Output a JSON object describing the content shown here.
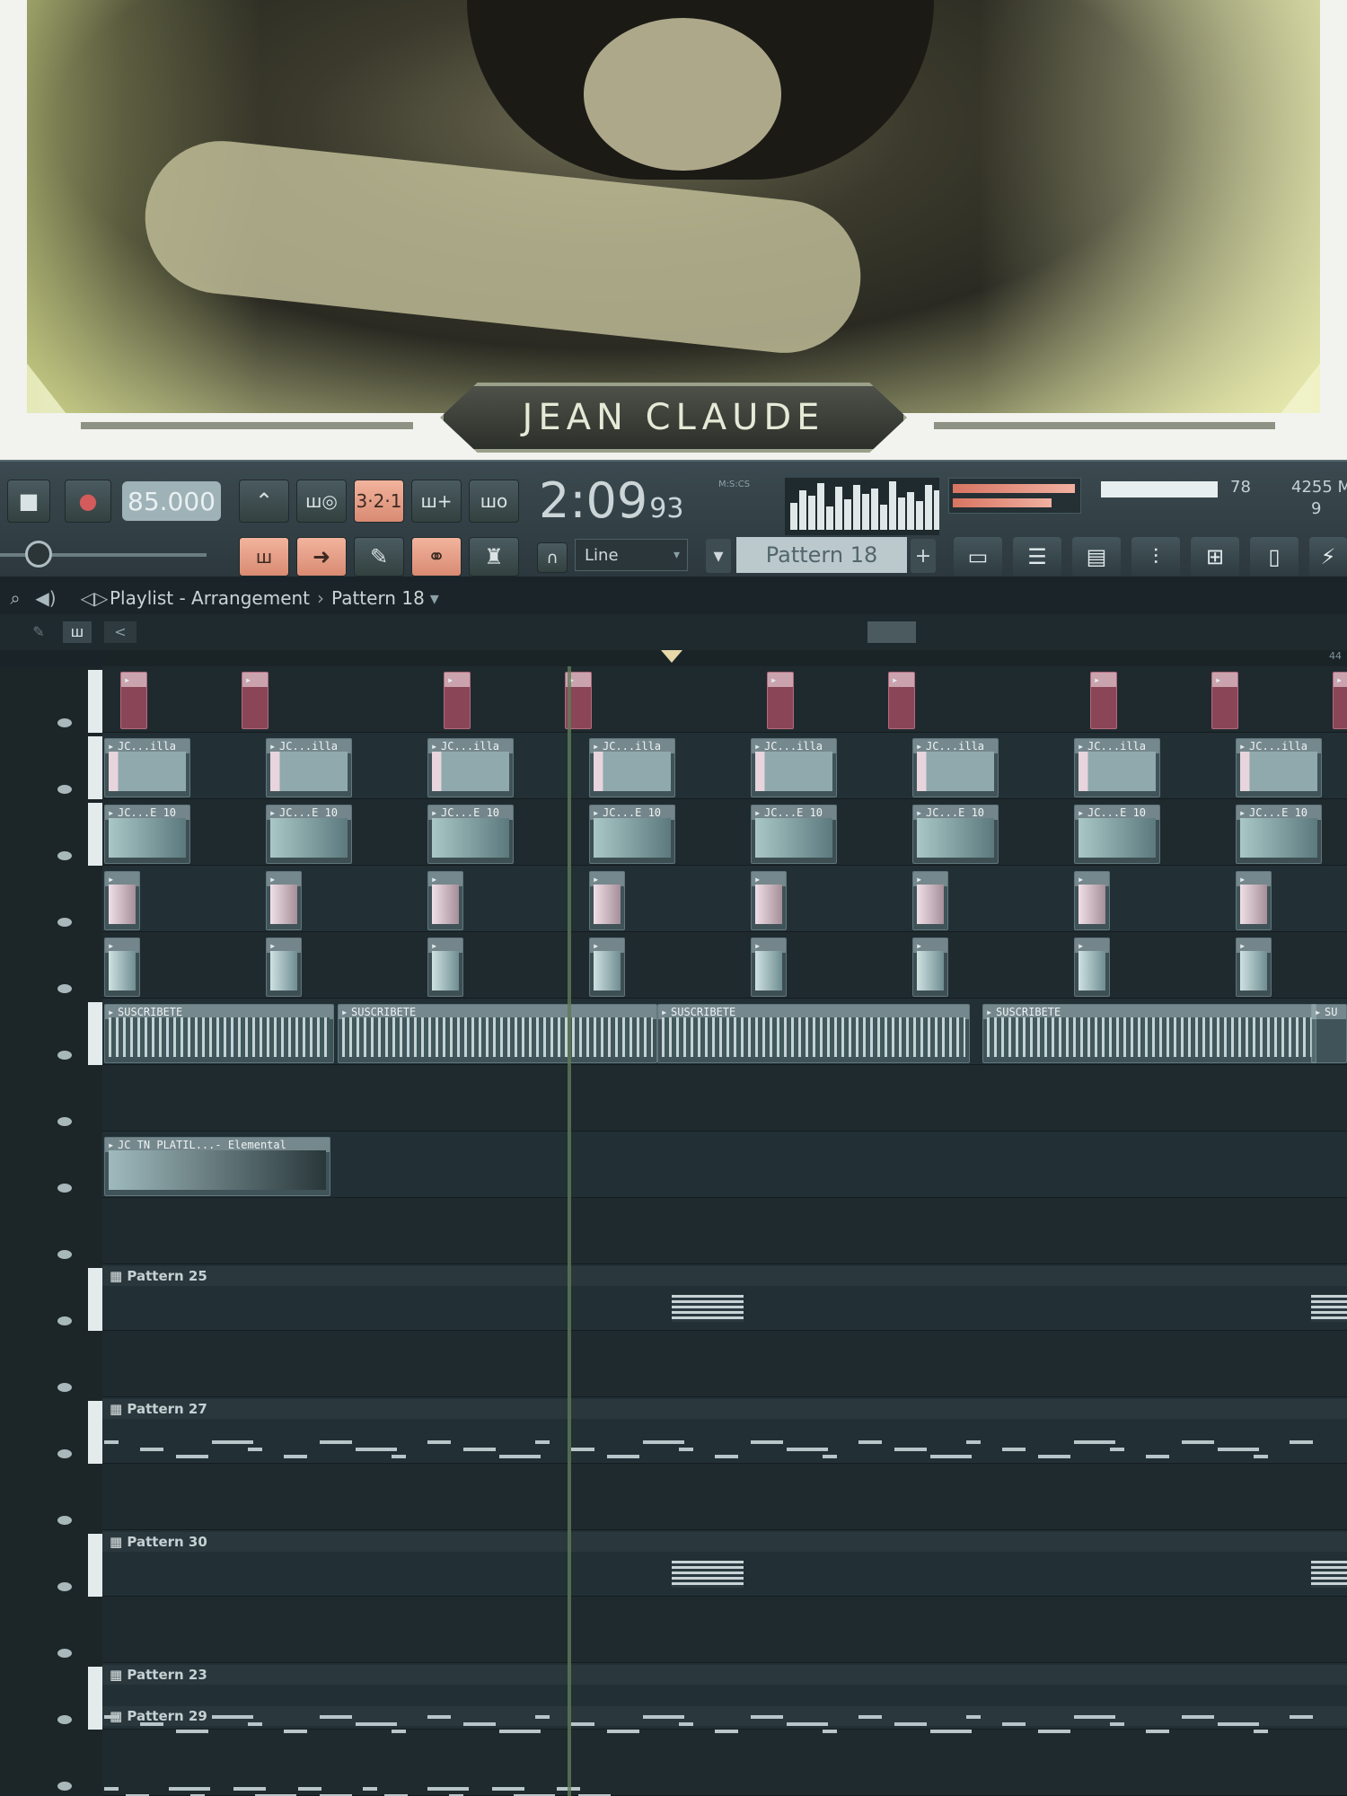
{
  "overlay": {
    "banner_text": "JEAN CLAUDE"
  },
  "toolbar": {
    "tempo": "85.000",
    "song_time": "2:09",
    "song_time_sub": "93",
    "time_unit_label": "M:S:CS",
    "cpu_value": "78",
    "memory_value": "4255 M",
    "poly_value": "9",
    "snap_mode": "Line",
    "pattern_selected": "Pattern 18",
    "pattern_prev": "▾",
    "pattern_add": "+"
  },
  "playlist": {
    "title": "Playlist - Arrangement",
    "separator": "›",
    "pattern": "Pattern 18",
    "pattern_arrow": "▾",
    "ruler_end": "44",
    "clip_labels": {
      "kick": "",
      "pad": "JC...illa",
      "perc": "JC...E 10",
      "voice": "SUSCRIBETE",
      "voice_partial": "SU",
      "fx": "JC TN PLATIL...- Elemental"
    },
    "patterns": [
      {
        "name": "Pattern 25"
      },
      {
        "name": "Pattern 27"
      },
      {
        "name": "Pattern 30"
      },
      {
        "name": "Pattern 23"
      },
      {
        "name": "Pattern 29"
      }
    ]
  },
  "colors": {
    "accent": "#f2b39d",
    "clip_red": "#8a4657",
    "background": "#1f2a2f"
  }
}
